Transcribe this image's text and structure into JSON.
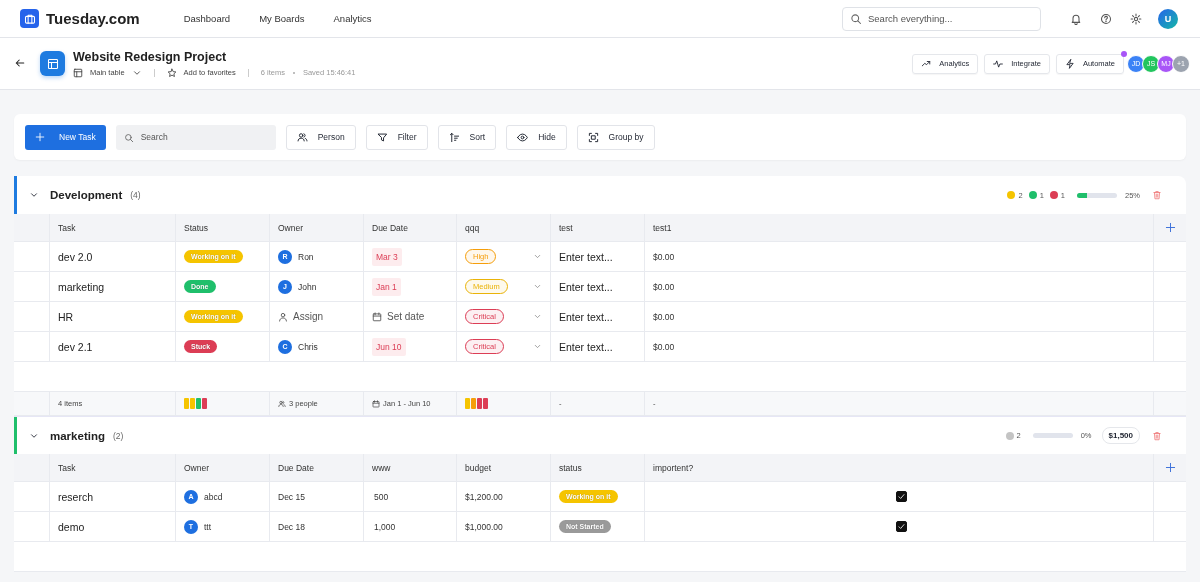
{
  "app": {
    "logo": "Tuesday.com",
    "nav": [
      {
        "label": "Dashboard"
      },
      {
        "label": "My Boards"
      },
      {
        "label": "Analytics"
      }
    ],
    "search_placeholder": "Search everything...",
    "user_initial": "U"
  },
  "board": {
    "title": "Website Redesign Project",
    "view": "Main table",
    "favorite": "Add to favorites",
    "item_count": "6 items",
    "saved": "Saved 15:46:41",
    "actions": [
      {
        "kind": "trend",
        "label": "Analytics",
        "notification": false
      },
      {
        "kind": "pulse",
        "label": "Integrate",
        "notification": false
      },
      {
        "kind": "bolt",
        "label": "Automate",
        "notification": true
      }
    ],
    "members": [
      {
        "initials": "JD",
        "color": "#3b82f6"
      },
      {
        "initials": "JS",
        "color": "#22c55e"
      },
      {
        "initials": "MJ",
        "color": "#a855f7"
      },
      {
        "initials": "+1",
        "color": "#9ca3af"
      }
    ]
  },
  "toolbar": {
    "new_task": "New Task",
    "search_placeholder": "Search",
    "buttons": [
      {
        "kind": "person",
        "label": "Person"
      },
      {
        "kind": "filter",
        "label": "Filter"
      },
      {
        "kind": "sort",
        "label": "Sort"
      },
      {
        "kind": "eye",
        "label": "Hide"
      },
      {
        "kind": "group",
        "label": "Group by"
      }
    ]
  },
  "groups": [
    {
      "name": "Development",
      "count": "(4)",
      "color": "#1e7be0",
      "expanded": true,
      "status_counts": [
        {
          "count": "2",
          "color": "#f5c400"
        },
        {
          "count": "1",
          "color": "#1fbf6b"
        },
        {
          "count": "1",
          "color": "#dc3d55"
        }
      ],
      "progress": {
        "level": 0.25,
        "label": "25%"
      },
      "columns": [
        {
          "label": "Task"
        },
        {
          "label": "Status"
        },
        {
          "label": "Owner"
        },
        {
          "label": "Due Date"
        },
        {
          "label": "qqq"
        },
        {
          "label": "test"
        },
        {
          "label": "test1"
        }
      ],
      "rows": [
        {
          "cells": [
            {
              "kind": "label",
              "text": "dev 2.0"
            },
            {
              "kind": "status",
              "text": "Working on it",
              "color": "#f5c400"
            },
            {
              "kind": "person",
              "initial": "R",
              "name": "Ron"
            },
            {
              "kind": "date",
              "text": "Mar 3",
              "overdue": true
            },
            {
              "kind": "priority",
              "text": "High",
              "color": "#f59e0b"
            },
            {
              "kind": "label",
              "text": "Enter text..."
            },
            {
              "kind": "text",
              "text": "$0.00"
            }
          ]
        },
        {
          "cells": [
            {
              "kind": "label",
              "text": "marketing"
            },
            {
              "kind": "status",
              "text": "Done",
              "color": "#1fbf6b"
            },
            {
              "kind": "person",
              "initial": "J",
              "name": "John"
            },
            {
              "kind": "date",
              "text": "Jan 1",
              "overdue": true
            },
            {
              "kind": "priority",
              "text": "Medium",
              "color": "#eab308"
            },
            {
              "kind": "label",
              "text": "Enter text..."
            },
            {
              "kind": "text",
              "text": "$0.00"
            }
          ]
        },
        {
          "cells": [
            {
              "kind": "label",
              "text": "HR"
            },
            {
              "kind": "status",
              "text": "Working on it",
              "color": "#f5c400"
            },
            {
              "kind": "assign",
              "text": "Assign"
            },
            {
              "kind": "set-date",
              "text": "Set date"
            },
            {
              "kind": "priority",
              "text": "Critical",
              "color": "#dc3d55"
            },
            {
              "kind": "label",
              "text": "Enter text..."
            },
            {
              "kind": "text",
              "text": "$0.00"
            }
          ]
        },
        {
          "cells": [
            {
              "kind": "label",
              "text": "dev 2.1"
            },
            {
              "kind": "status",
              "text": "Stuck",
              "color": "#dc3d55"
            },
            {
              "kind": "person",
              "initial": "C",
              "name": "Chris"
            },
            {
              "kind": "date",
              "text": "Jun 10",
              "overdue": true
            },
            {
              "kind": "priority",
              "text": "Critical",
              "color": "#dc3d55"
            },
            {
              "kind": "label",
              "text": "Enter text..."
            },
            {
              "kind": "text",
              "text": "$0.00"
            }
          ]
        }
      ],
      "footer": [
        {
          "kind": "text",
          "text": "4 items"
        },
        {
          "kind": "bars",
          "bars": [
            {
              "color": "#f5c400"
            },
            {
              "color": "#f5c400"
            },
            {
              "color": "#1fbf6b"
            },
            {
              "color": "#dc3d55"
            }
          ]
        },
        {
          "kind": "people",
          "text": "3 people"
        },
        {
          "kind": "range",
          "text": "Jan 1 - Jun 10"
        },
        {
          "kind": "bars",
          "bars": [
            {
              "color": "#f5c400"
            },
            {
              "color": "#f59e0b"
            },
            {
              "color": "#dc3d55"
            },
            {
              "color": "#dc3d55"
            }
          ]
        },
        {
          "kind": "text",
          "text": "-"
        },
        {
          "kind": "text",
          "text": "-"
        }
      ]
    },
    {
      "name": "marketing",
      "count": "(2)",
      "color": "#1fbf6b",
      "expanded": true,
      "status_counts": [
        {
          "count": "2",
          "color": "#c4c4c4"
        }
      ],
      "progress": {
        "level": 0,
        "label": "0%"
      },
      "total": "$1,500",
      "columns": [
        {
          "label": "Task"
        },
        {
          "label": "Owner"
        },
        {
          "label": "Due Date"
        },
        {
          "label": "www"
        },
        {
          "label": "budget"
        },
        {
          "label": "status"
        },
        {
          "label": "importent?"
        }
      ],
      "rows": [
        {
          "cells": [
            {
              "kind": "label",
              "text": "reserch"
            },
            {
              "kind": "person",
              "initial": "A",
              "name": "abcd"
            },
            {
              "kind": "text",
              "text": "Dec 15"
            },
            {
              "kind": "number",
              "text": "500"
            },
            {
              "kind": "text",
              "text": "$1,200.00"
            },
            {
              "kind": "status",
              "text": "Working on it",
              "color": "#f5c400"
            },
            {
              "kind": "checkbox",
              "checked": true
            }
          ]
        },
        {
          "cells": [
            {
              "kind": "label",
              "text": "demo"
            },
            {
              "kind": "person",
              "initial": "T",
              "name": "ttt"
            },
            {
              "kind": "text",
              "text": "Dec 18"
            },
            {
              "kind": "number",
              "text": "1,000"
            },
            {
              "kind": "text",
              "text": "$1,000.00"
            },
            {
              "kind": "status",
              "text": "Not Started",
              "color": "#9a9a9a"
            },
            {
              "kind": "checkbox",
              "checked": true
            }
          ]
        }
      ]
    }
  ]
}
